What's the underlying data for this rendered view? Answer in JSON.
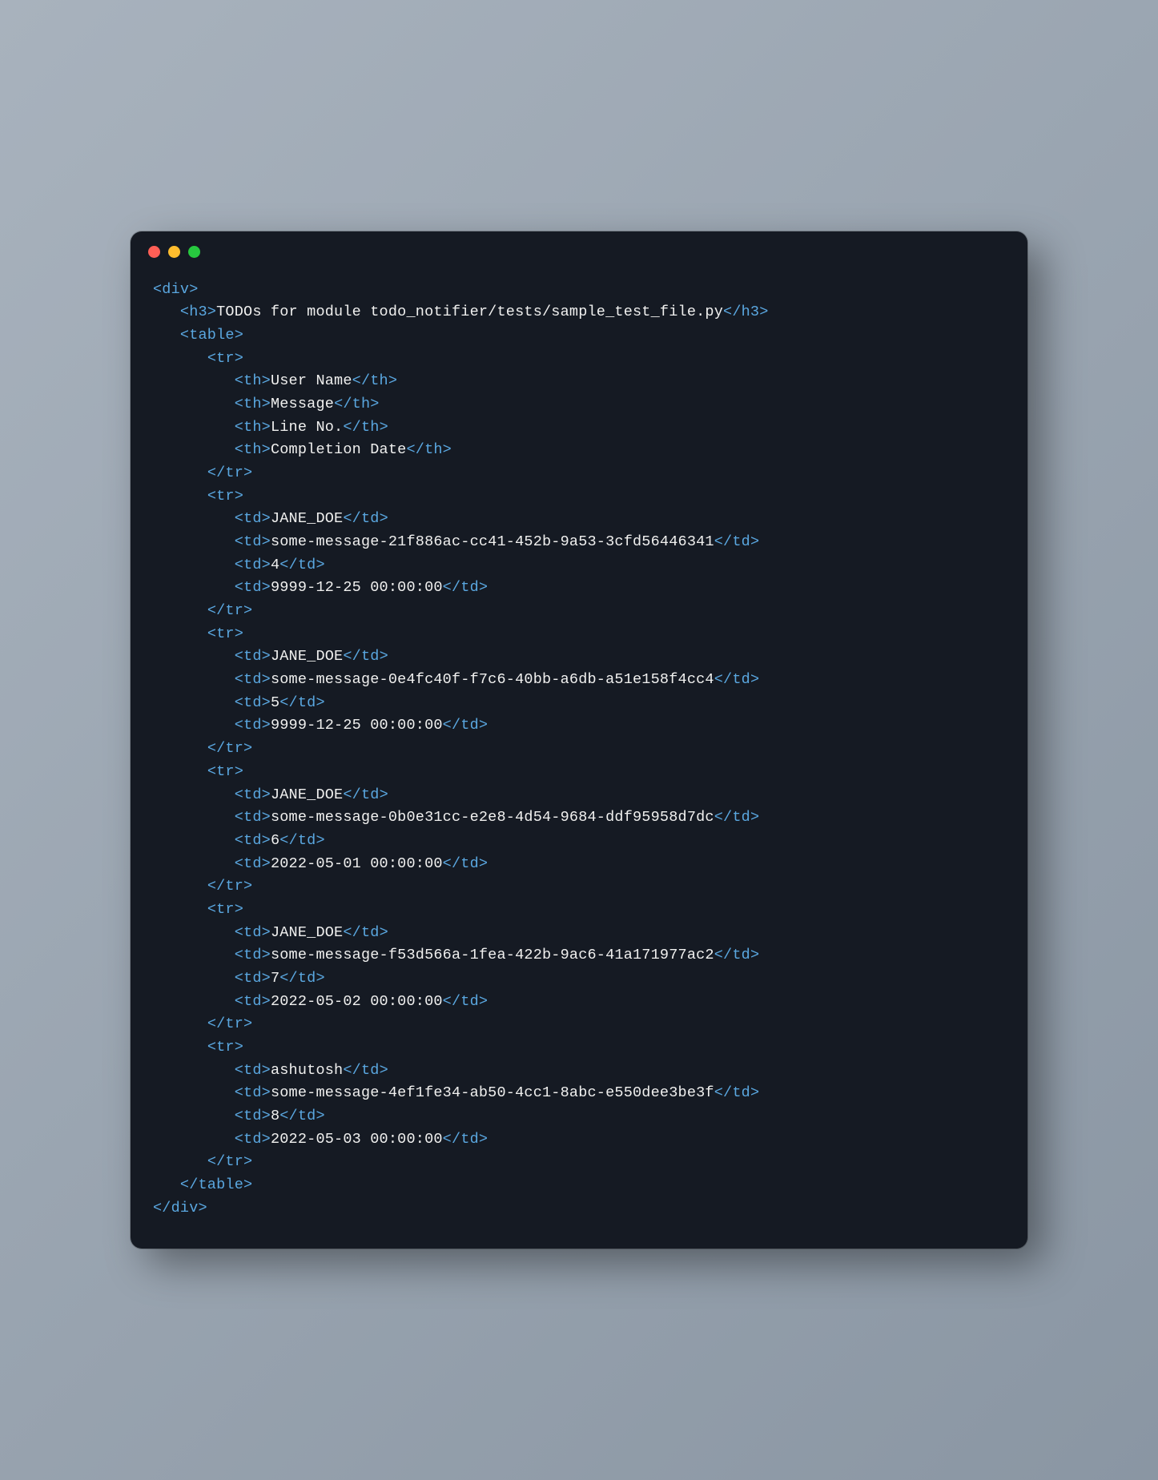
{
  "window": {
    "dots": [
      "red",
      "yellow",
      "green"
    ]
  },
  "code": {
    "heading": "TODOs for module todo_notifier/tests/sample_test_file.py",
    "headers": [
      "User Name",
      "Message",
      "Line No.",
      "Completion Date"
    ],
    "rows": [
      {
        "user": "JANE_DOE",
        "message": "some-message-21f886ac-cc41-452b-9a53-3cfd56446341",
        "line": "4",
        "date": "9999-12-25 00:00:00"
      },
      {
        "user": "JANE_DOE",
        "message": "some-message-0e4fc40f-f7c6-40bb-a6db-a51e158f4cc4",
        "line": "5",
        "date": "9999-12-25 00:00:00"
      },
      {
        "user": "JANE_DOE",
        "message": "some-message-0b0e31cc-e2e8-4d54-9684-ddf95958d7dc",
        "line": "6",
        "date": "2022-05-01 00:00:00"
      },
      {
        "user": "JANE_DOE",
        "message": "some-message-f53d566a-1fea-422b-9ac6-41a171977ac2",
        "line": "7",
        "date": "2022-05-02 00:00:00"
      },
      {
        "user": "ashutosh",
        "message": "some-message-4ef1fe34-ab50-4cc1-8abc-e550dee3be3f",
        "line": "8",
        "date": "2022-05-03 00:00:00"
      }
    ]
  }
}
